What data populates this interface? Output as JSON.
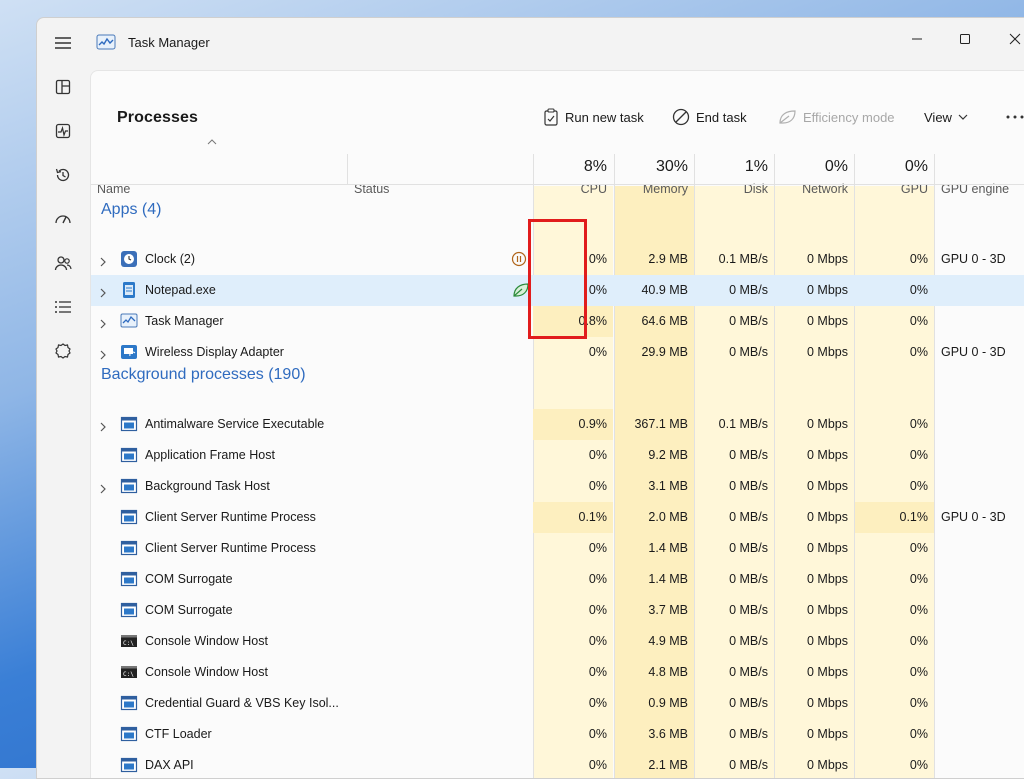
{
  "window": {
    "title": "Task Manager"
  },
  "nav": {
    "items": [
      {
        "name": "hamburger-menu-icon"
      },
      {
        "name": "processes-icon"
      },
      {
        "name": "performance-icon"
      },
      {
        "name": "app-history-icon"
      },
      {
        "name": "startup-apps-icon"
      },
      {
        "name": "users-icon"
      },
      {
        "name": "details-icon"
      },
      {
        "name": "services-icon"
      }
    ]
  },
  "page": {
    "title": "Processes"
  },
  "toolbar": {
    "run_new_task": "Run new task",
    "end_task": "End task",
    "efficiency_mode": "Efficiency mode",
    "view": "View"
  },
  "columns": {
    "name": "Name",
    "status": "Status",
    "cpu": {
      "pct": "8%",
      "label": "CPU"
    },
    "memory": {
      "pct": "30%",
      "label": "Memory"
    },
    "disk": {
      "pct": "1%",
      "label": "Disk"
    },
    "network": {
      "pct": "0%",
      "label": "Network"
    },
    "gpu": {
      "pct": "0%",
      "label": "GPU"
    },
    "gpu_engine": {
      "label": "GPU engine"
    }
  },
  "groups": {
    "apps": "Apps (4)",
    "background": "Background processes (190)"
  },
  "apps": [
    {
      "name": "Clock (2)",
      "icon": "clock-icon",
      "expand": true,
      "status": "suspended-icon",
      "cpu": "0%",
      "memory": "2.9 MB",
      "disk": "0.1 MB/s",
      "network": "0 Mbps",
      "gpu": "0%",
      "gpu_engine": "GPU 0 - 3D"
    },
    {
      "name": "Notepad.exe",
      "icon": "notepad-icon",
      "expand": true,
      "status": "efficiency-leaf-icon",
      "cpu": "0%",
      "memory": "40.9 MB",
      "disk": "0 MB/s",
      "network": "0 Mbps",
      "gpu": "0%",
      "gpu_engine": "",
      "selected": true
    },
    {
      "name": "Task Manager",
      "icon": "task-manager-icon",
      "expand": true,
      "status": "",
      "cpu": "0.8%",
      "memory": "64.6 MB",
      "disk": "0 MB/s",
      "network": "0 Mbps",
      "gpu": "0%",
      "gpu_engine": ""
    },
    {
      "name": "Wireless Display Adapter",
      "icon": "wireless-display-icon",
      "expand": true,
      "status": "",
      "cpu": "0%",
      "memory": "29.9 MB",
      "disk": "0 MB/s",
      "network": "0 Mbps",
      "gpu": "0%",
      "gpu_engine": "GPU 0 - 3D"
    }
  ],
  "background": [
    {
      "name": "Antimalware Service Executable",
      "icon": "app-window-icon",
      "expand": true,
      "cpu": "0.9%",
      "memory": "367.1 MB",
      "disk": "0.1 MB/s",
      "network": "0 Mbps",
      "gpu": "0%",
      "gpu_engine": ""
    },
    {
      "name": "Application Frame Host",
      "icon": "app-window-icon",
      "expand": false,
      "cpu": "0%",
      "memory": "9.2 MB",
      "disk": "0 MB/s",
      "network": "0 Mbps",
      "gpu": "0%",
      "gpu_engine": ""
    },
    {
      "name": "Background Task Host",
      "icon": "app-window-icon",
      "expand": true,
      "cpu": "0%",
      "memory": "3.1 MB",
      "disk": "0 MB/s",
      "network": "0 Mbps",
      "gpu": "0%",
      "gpu_engine": ""
    },
    {
      "name": "Client Server Runtime Process",
      "icon": "app-window-icon",
      "expand": false,
      "cpu": "0.1%",
      "memory": "2.0 MB",
      "disk": "0 MB/s",
      "network": "0 Mbps",
      "gpu": "0.1%",
      "gpu_engine": "GPU 0 - 3D"
    },
    {
      "name": "Client Server Runtime Process",
      "icon": "app-window-icon",
      "expand": false,
      "cpu": "0%",
      "memory": "1.4 MB",
      "disk": "0 MB/s",
      "network": "0 Mbps",
      "gpu": "0%",
      "gpu_engine": ""
    },
    {
      "name": "COM Surrogate",
      "icon": "app-window-icon",
      "expand": false,
      "cpu": "0%",
      "memory": "1.4 MB",
      "disk": "0 MB/s",
      "network": "0 Mbps",
      "gpu": "0%",
      "gpu_engine": ""
    },
    {
      "name": "COM Surrogate",
      "icon": "app-window-icon",
      "expand": false,
      "cpu": "0%",
      "memory": "3.7 MB",
      "disk": "0 MB/s",
      "network": "0 Mbps",
      "gpu": "0%",
      "gpu_engine": ""
    },
    {
      "name": "Console Window Host",
      "icon": "console-icon",
      "expand": false,
      "cpu": "0%",
      "memory": "4.9 MB",
      "disk": "0 MB/s",
      "network": "0 Mbps",
      "gpu": "0%",
      "gpu_engine": ""
    },
    {
      "name": "Console Window Host",
      "icon": "console-icon",
      "expand": false,
      "cpu": "0%",
      "memory": "4.8 MB",
      "disk": "0 MB/s",
      "network": "0 Mbps",
      "gpu": "0%",
      "gpu_engine": ""
    },
    {
      "name": "Credential Guard & VBS Key Isol...",
      "icon": "app-window-icon",
      "expand": false,
      "cpu": "0%",
      "memory": "0.9 MB",
      "disk": "0 MB/s",
      "network": "0 Mbps",
      "gpu": "0%",
      "gpu_engine": ""
    },
    {
      "name": "CTF Loader",
      "icon": "app-window-icon",
      "expand": false,
      "cpu": "0%",
      "memory": "3.6 MB",
      "disk": "0 MB/s",
      "network": "0 Mbps",
      "gpu": "0%",
      "gpu_engine": ""
    },
    {
      "name": "DAX API",
      "icon": "app-window-icon",
      "expand": false,
      "cpu": "0%",
      "memory": "2.1 MB",
      "disk": "0 MB/s",
      "network": "0 Mbps",
      "gpu": "0%",
      "gpu_engine": ""
    }
  ],
  "colors": {
    "accent_blue": "#2f6bbf",
    "selected_row": "#dfeefb",
    "heat_light": "#fff7d9",
    "heat_mid": "#fdefbf",
    "annotation_red": "#e11c1c"
  }
}
